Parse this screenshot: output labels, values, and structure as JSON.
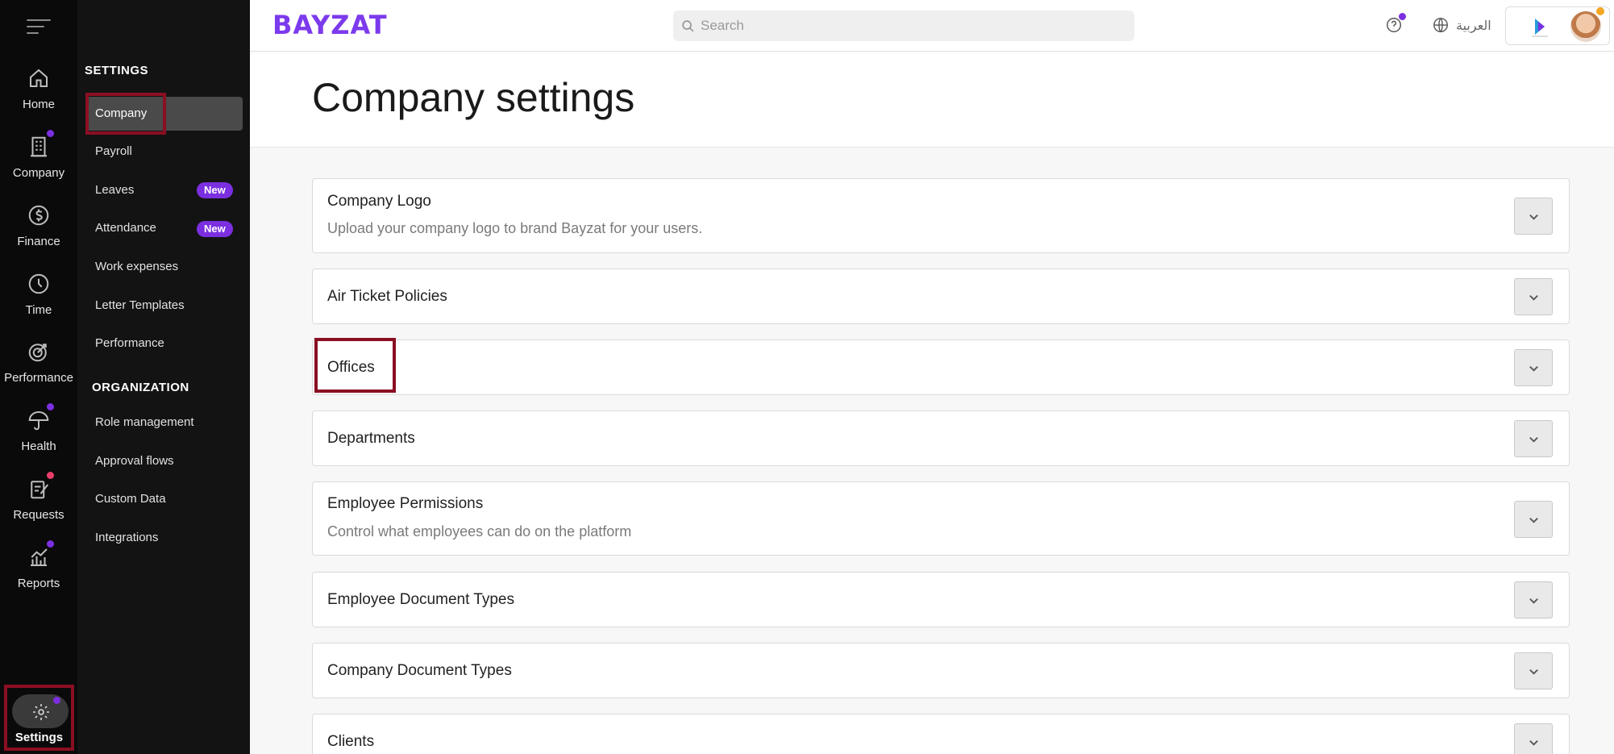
{
  "colors": {
    "accent": "#7b2fe0",
    "highlight": "#8b0f22",
    "rail_bg": "#0a0a0a",
    "subnav_bg": "#131313",
    "notify_red": "#e83e6c",
    "notify_orange": "#f5a623"
  },
  "rail": {
    "items": [
      {
        "label": "Home",
        "icon": "home-icon"
      },
      {
        "label": "Company",
        "icon": "building-icon"
      },
      {
        "label": "Finance",
        "icon": "dollar-icon"
      },
      {
        "label": "Time",
        "icon": "clock-icon"
      },
      {
        "label": "Performance",
        "icon": "target-icon"
      },
      {
        "label": "Health",
        "icon": "umbrella-icon"
      },
      {
        "label": "Requests",
        "icon": "clipboard-icon"
      },
      {
        "label": "Reports",
        "icon": "chart-icon"
      }
    ],
    "settings_label": "Settings"
  },
  "subnav": {
    "settings_heading": "SETTINGS",
    "settings_items": [
      {
        "label": "Company"
      },
      {
        "label": "Payroll"
      },
      {
        "label": "Leaves",
        "badge": "New"
      },
      {
        "label": "Attendance",
        "badge": "New"
      },
      {
        "label": "Work expenses"
      },
      {
        "label": "Letter Templates"
      },
      {
        "label": "Performance"
      }
    ],
    "organization_heading": "ORGANIZATION",
    "organization_items": [
      {
        "label": "Role management"
      },
      {
        "label": "Approval flows"
      },
      {
        "label": "Custom Data"
      },
      {
        "label": "Integrations"
      }
    ]
  },
  "topbar": {
    "brand": "BAYZAT",
    "search_placeholder": "Search",
    "language": "العربية"
  },
  "page": {
    "title": "Company settings"
  },
  "cards": [
    {
      "title": "Company Logo",
      "description": "Upload your company logo to brand Bayzat for your users."
    },
    {
      "title": "Air Ticket Policies"
    },
    {
      "title": "Offices"
    },
    {
      "title": "Departments"
    },
    {
      "title": "Employee Permissions",
      "description": "Control what employees can do on the platform"
    },
    {
      "title": "Employee Document Types"
    },
    {
      "title": "Company Document Types"
    },
    {
      "title": "Clients"
    }
  ]
}
